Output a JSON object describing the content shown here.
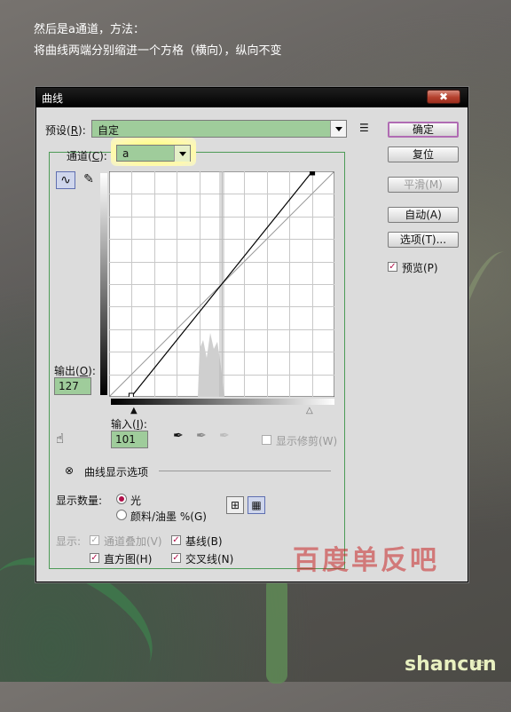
{
  "intro": {
    "line1": "然后是a通道，方法：",
    "line2": "将曲线两端分别缩进一个方格（横向），纵向不变"
  },
  "dialog": {
    "title": "曲线",
    "close_label": "✖",
    "preset": {
      "label": "预设(",
      "key": "R",
      "label_end": "):",
      "value": "自定"
    },
    "channel": {
      "label": "通道(",
      "key": "C",
      "label_end": "):",
      "value": "a"
    },
    "output": {
      "label": "输出(",
      "key": "O",
      "label_end": "):",
      "value": "127"
    },
    "input": {
      "label": "输入(",
      "key": "I",
      "label_end": "):",
      "value": "101"
    },
    "show_clipping": "显示修剪(W)",
    "display_options_label": "曲线显示选项",
    "show_amount_label": "显示数量:",
    "light_label": "光",
    "pigment_label": "颜料/油墨 %(G)",
    "show_label": "显示:",
    "channel_overlays": "通道叠加(V)",
    "baseline": "基线(B)",
    "histogram": "直方图(H)",
    "intersection": "交叉线(N)",
    "buttons": {
      "ok": "确定",
      "reset": "复位",
      "smooth": "平滑(M)",
      "auto": "自动(A)",
      "options": "选项(T)...",
      "preview": "预览(P)"
    },
    "curve": {
      "start": [
        25,
        0
      ],
      "end": [
        230,
        255
      ]
    }
  },
  "watermark": "百度单反吧",
  "logo": {
    "main": "shancun",
    "sub": ".net"
  }
}
